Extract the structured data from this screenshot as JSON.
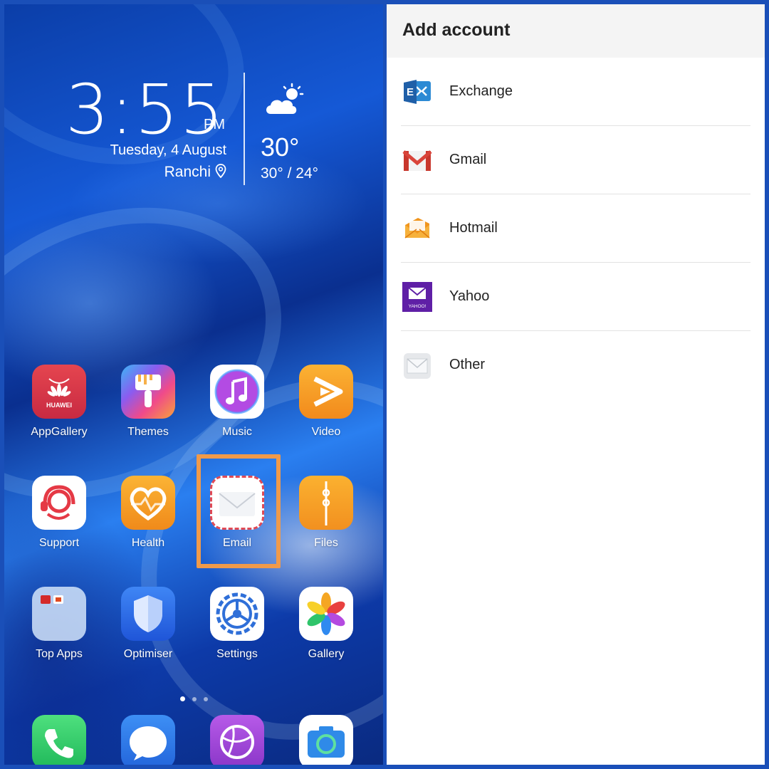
{
  "home": {
    "clock": {
      "time": "3:55",
      "ampm": "PM",
      "date": "Tuesday, 4 August",
      "location": "Ranchi"
    },
    "weather": {
      "temp": "30°",
      "range": "30° / 24°",
      "icon": "partly-sunny-icon"
    },
    "apps_row1": [
      {
        "label": "AppGallery",
        "icon": "huawei-appgallery-icon",
        "color": "#d8344a"
      },
      {
        "label": "Themes",
        "icon": "paintbrush-icon",
        "color": "#f07b3a"
      },
      {
        "label": "Music",
        "icon": "music-note-icon",
        "color": "#b247e0"
      },
      {
        "label": "Video",
        "icon": "play-icon",
        "color": "#f5a623"
      }
    ],
    "apps_row2": [
      {
        "label": "Support",
        "icon": "headset-agent-icon",
        "color": "#e53945"
      },
      {
        "label": "Health",
        "icon": "heart-icon",
        "color": "#f5a020"
      },
      {
        "label": "Email",
        "icon": "envelope-icon",
        "color": "#ffffff"
      },
      {
        "label": "Files",
        "icon": "folder-icon",
        "color": "#f7a325"
      }
    ],
    "apps_row3": [
      {
        "label": "Top Apps",
        "icon": "folder-grid-icon",
        "color": "#cfe0f5"
      },
      {
        "label": "Optimiser",
        "icon": "shield-icon",
        "color": "#2f6fe8"
      },
      {
        "label": "Settings",
        "icon": "gear-icon",
        "color": "#ffffff"
      },
      {
        "label": "Gallery",
        "icon": "pinwheel-icon",
        "color": "#ffffff"
      }
    ],
    "dock": [
      {
        "icon": "phone-icon",
        "color": "#2fcf6a"
      },
      {
        "icon": "message-bubble-icon",
        "color": "#2f7fe8"
      },
      {
        "icon": "browser-globe-icon",
        "color": "#a54ad8"
      },
      {
        "icon": "camera-icon",
        "color": "#ffffff"
      }
    ]
  },
  "panel": {
    "title": "Add account",
    "accounts": [
      {
        "label": "Exchange",
        "icon": "exchange-icon"
      },
      {
        "label": "Gmail",
        "icon": "gmail-icon"
      },
      {
        "label": "Hotmail",
        "icon": "hotmail-icon"
      },
      {
        "label": "Yahoo",
        "icon": "yahoo-mail-icon"
      },
      {
        "label": "Other",
        "icon": "generic-mail-icon"
      }
    ]
  }
}
